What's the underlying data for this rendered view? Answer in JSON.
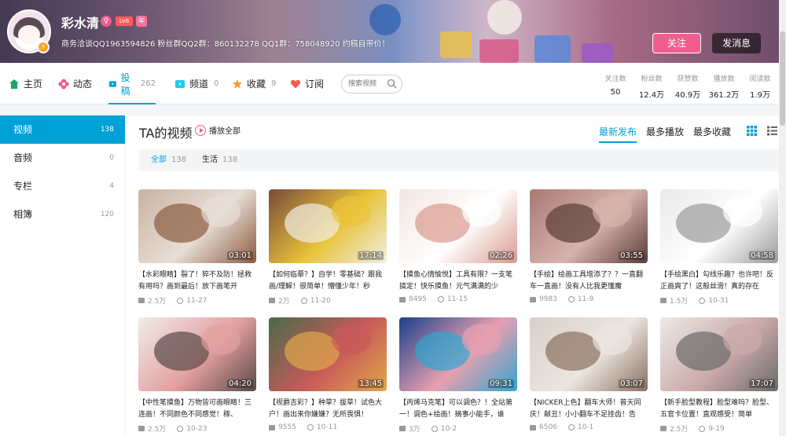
{
  "user": {
    "name": "彩水清",
    "gender_icon": "female-icon",
    "level_badge": "LV6",
    "vip_badge": "年",
    "signature": "商务洽谈QQ1963594826 粉丝群QQ2群：860132278 QQ1群：758048920 约稿自带价！",
    "follow_label": "关注",
    "message_label": "发消息"
  },
  "nav": {
    "items": [
      {
        "label": "主页",
        "count": "",
        "icon": "home-icon",
        "color": "#1aa36b"
      },
      {
        "label": "动态",
        "count": "",
        "icon": "flower-icon",
        "color": "#f25d8e"
      },
      {
        "label": "投稿",
        "count": "262",
        "icon": "video-icon",
        "color": "#00a1d6"
      },
      {
        "label": "频道",
        "count": "0",
        "icon": "channel-icon",
        "color": "#23c9ed"
      },
      {
        "label": "收藏",
        "count": "9",
        "icon": "star-icon",
        "color": "#f3a034"
      },
      {
        "label": "订阅",
        "count": "",
        "icon": "heart-icon",
        "color": "#f45a4a"
      }
    ],
    "search_placeholder": "搜索视频"
  },
  "stats": [
    {
      "label": "关注数",
      "value": "50"
    },
    {
      "label": "粉丝数",
      "value": "12.4万"
    },
    {
      "label": "获赞数",
      "value": "40.9万"
    },
    {
      "label": "播放数",
      "value": "361.2万"
    },
    {
      "label": "阅读数",
      "value": "1.9万"
    }
  ],
  "sidebar": {
    "items": [
      {
        "label": "视频",
        "count": "138"
      },
      {
        "label": "音频",
        "count": "0"
      },
      {
        "label": "专栏",
        "count": "4"
      },
      {
        "label": "相簿",
        "count": "120"
      }
    ]
  },
  "main": {
    "title": "TA的视频",
    "play_all": "播放全部",
    "sorts": [
      "最新发布",
      "最多播放",
      "最多收藏"
    ],
    "filters": [
      {
        "label": "全部",
        "count": "138"
      },
      {
        "label": "生活",
        "count": "138"
      }
    ]
  },
  "videos": [
    {
      "title": "【水彩眼睛】裂了！猝不及防！拯救有用吗？画到最后！放下画笔开",
      "duration": "03:01",
      "plays": "2.5万",
      "date": "11-27",
      "colors": [
        "#c9b3a2",
        "#8a5b3f",
        "#e8ddd5"
      ]
    },
    {
      "title": "【如何临摹？】自学！零基础？跟我画/理解！很简单！懵懂少年！秒",
      "duration": "17:14",
      "plays": "2万",
      "date": "11-20",
      "colors": [
        "#7a4a3a",
        "#f0eee6",
        "#e8c33a"
      ]
    },
    {
      "title": "【摸鱼心情愉悦】工具有限？一支笔搞定！快乐摸鱼！元气满满的少",
      "duration": "02:26",
      "plays": "8495",
      "date": "11-15",
      "colors": [
        "#f2e6e0",
        "#d89a8e",
        "#ffffff"
      ]
    },
    {
      "title": "【手绘】绘画工具增添了？？一直翻车一直画！没有人比我更懂魔",
      "duration": "03:55",
      "plays": "9983",
      "date": "11-9",
      "colors": [
        "#a87a74",
        "#5a3c38",
        "#d7b3ad"
      ]
    },
    {
      "title": "【手绘黑白】勾线乐趣？也许吧！反正画爽了！这般丝滑！真的存在",
      "duration": "04:58",
      "plays": "1.5万",
      "date": "10-31",
      "colors": [
        "#e9e9e9",
        "#9a9a9a",
        "#ffffff"
      ]
    },
    {
      "title": "【中性笔摸鱼】万物皆可画眼睛！三连画！不同颜色不同感觉！稼、",
      "duration": "04:20",
      "plays": "2.5万",
      "date": "10-23",
      "colors": [
        "#f0ece8",
        "#5a4a48",
        "#e3a0a0"
      ]
    },
    {
      "title": "【视爵吉彩？】种草？拔草！试色大户！画出来你嫌嫌？无所畏惧！",
      "duration": "13:45",
      "plays": "9555",
      "date": "10-11",
      "colors": [
        "#4a6a4a",
        "#e0a84a",
        "#c85a5a"
      ]
    },
    {
      "title": "【丙烯马克笔】可以调色？！全站第一！调色+绘画！摘事小能手，谁",
      "duration": "09:31",
      "plays": "3万",
      "date": "10-2",
      "colors": [
        "#1a3f8a",
        "#2fa6d0",
        "#e8a0b0"
      ]
    },
    {
      "title": "【NICKER上色】翻车大师！普天同庆！献丑！小小翻车不足挂齿！告",
      "duration": "03:07",
      "plays": "6506",
      "date": "10-1",
      "colors": [
        "#d8d0c8",
        "#8a7060",
        "#ece6e0"
      ]
    },
    {
      "title": "【新手脸型教程】脸型难吗？脸型、五官卡位置！直观感受！简单",
      "duration": "17:07",
      "plays": "2.5万",
      "date": "9-19",
      "colors": [
        "#eceae6",
        "#6a6a6a",
        "#caa"
      ]
    }
  ]
}
